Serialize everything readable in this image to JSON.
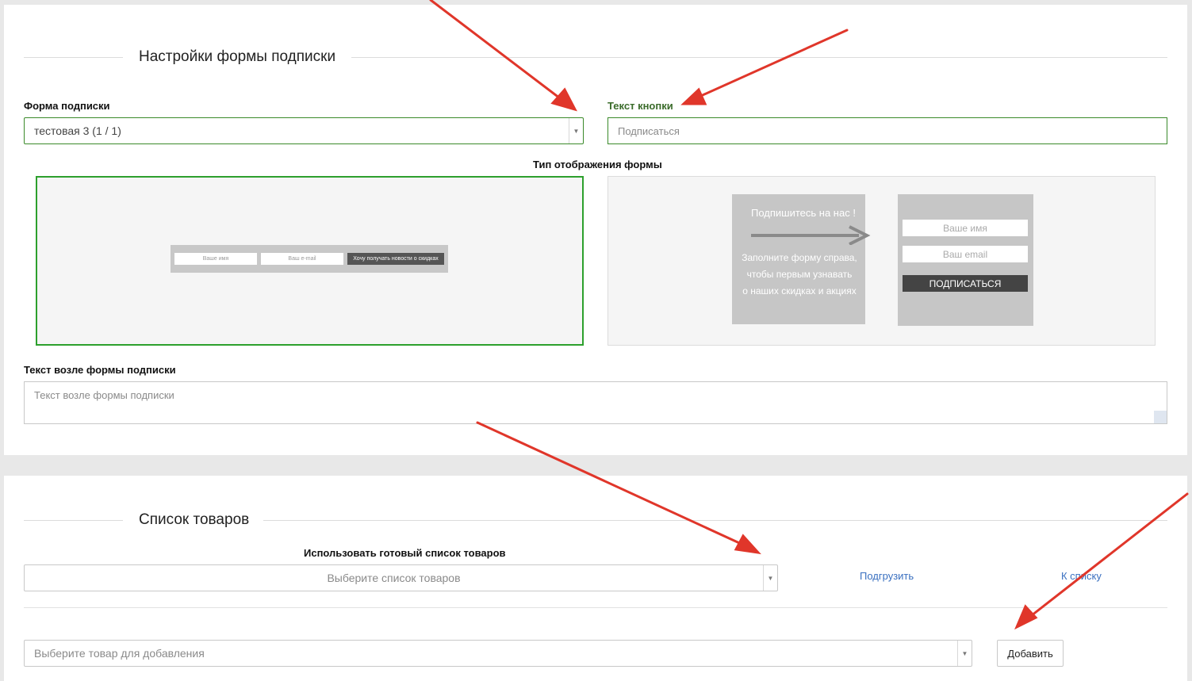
{
  "subscription_settings": {
    "section_title": "Настройки формы подписки",
    "form_label": "Форма подписки",
    "form_value": "тестовая 3 (1 / 1)",
    "button_text_label": "Текст кнопки",
    "button_text_placeholder": "Подписаться",
    "display_type_label": "Тип отображения формы",
    "preview_inline": {
      "name_placeholder": "Ваше имя",
      "email_placeholder": "Ваш e-mail",
      "button_label": "Хочу получать новости о скидках"
    },
    "preview_block": {
      "title": "Подпишитесь на нас !",
      "text_line1": "Заполните форму справа,",
      "text_line2": "чтобы первым узнавать",
      "text_line3": "о наших скидках и акциях",
      "name_placeholder": "Ваше имя",
      "email_placeholder": "Ваш email",
      "button_label": "ПОДПИСАТЬСЯ"
    },
    "nearby_text_label": "Текст возле формы подписки",
    "nearby_text_placeholder": "Текст возле формы подписки"
  },
  "product_list": {
    "section_title": "Список товаров",
    "ready_list_label": "Использовать готовый список товаров",
    "ready_list_placeholder": "Выберите список товаров",
    "load_link": "Подгрузить",
    "to_list_link": "К списку",
    "product_placeholder": "Выберите товар для добавления",
    "add_button": "Добавить"
  },
  "colors": {
    "accent_green": "#2da02d",
    "label_green": "#3a6b2a",
    "link_blue": "#3a70c0",
    "annotation_red": "#e0362a"
  }
}
